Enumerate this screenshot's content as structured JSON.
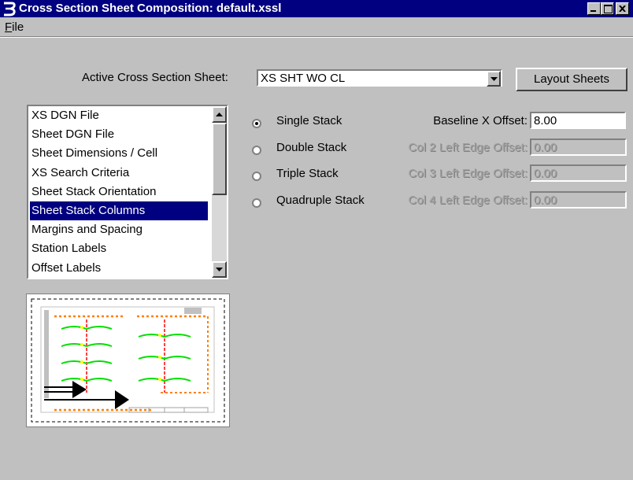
{
  "window": {
    "title": "Cross Section Sheet Composition: default.xssl",
    "minimize_label": "_",
    "maximize_label": "□",
    "close_label": "✕",
    "app_icon": "bentley-b-icon"
  },
  "menu": {
    "file": "File"
  },
  "toolbar": {
    "active_sheet_label": "Active Cross Section Sheet:",
    "active_sheet_value": "XS SHT WO CL",
    "layout_button": "Layout Sheets"
  },
  "list": {
    "items": [
      "XS DGN File",
      "Sheet DGN File",
      "Sheet Dimensions / Cell",
      "XS Search Criteria",
      "Sheet Stack Orientation",
      "Sheet Stack Columns",
      "Margins and Spacing",
      "Station Labels",
      "Offset Labels"
    ],
    "selected_index": 5
  },
  "stacks": {
    "options": [
      {
        "label": "Single Stack",
        "checked": true
      },
      {
        "label": "Double Stack",
        "checked": false
      },
      {
        "label": "Triple Stack",
        "checked": false
      },
      {
        "label": "Quadruple Stack",
        "checked": false
      }
    ],
    "fields": [
      {
        "label": "Baseline X Offset:",
        "value": "8.00",
        "enabled": true
      },
      {
        "label": "Col 2 Left Edge Offset:",
        "value": "0.00",
        "enabled": false
      },
      {
        "label": "Col 3 Left Edge Offset:",
        "value": "0.00",
        "enabled": false
      },
      {
        "label": "Col 4 Left Edge Offset:",
        "value": "0.00",
        "enabled": false
      }
    ]
  },
  "colors": {
    "titlebar": "#000080",
    "selection": "#000080",
    "face": "#c0c0c0",
    "preview_orange": "#ff8000",
    "preview_green": "#00e000",
    "preview_red": "#ff0000",
    "preview_yellow": "#ffff00"
  }
}
